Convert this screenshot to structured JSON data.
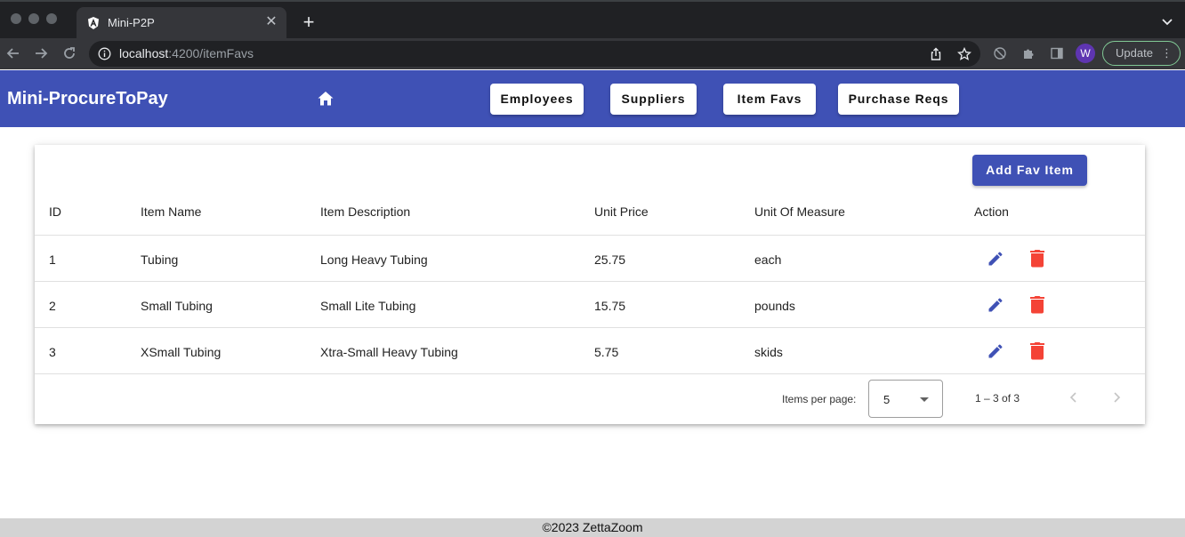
{
  "browser": {
    "tab_title": "Mini-P2P",
    "url_host": "localhost",
    "url_path": ":4200/itemFavs",
    "profile_initial": "W",
    "update_label": "Update"
  },
  "app": {
    "brand": "Mini-ProcureToPay",
    "nav": [
      "Employees",
      "Suppliers",
      "Item Favs",
      "Purchase Reqs"
    ]
  },
  "table": {
    "add_button": "Add Fav Item",
    "headers": [
      "ID",
      "Item Name",
      "Item Description",
      "Unit Price",
      "Unit Of Measure",
      "Action"
    ],
    "rows": [
      {
        "id": "1",
        "name": "Tubing",
        "description": "Long Heavy Tubing",
        "price": "25.75",
        "uom": "each"
      },
      {
        "id": "2",
        "name": "Small Tubing",
        "description": "Small Lite Tubing",
        "price": "15.75",
        "uom": "pounds"
      },
      {
        "id": "3",
        "name": "XSmall Tubing",
        "description": "Xtra-Small Heavy Tubing",
        "price": "5.75",
        "uom": "skids"
      }
    ]
  },
  "paginator": {
    "items_per_page_label": "Items per page:",
    "page_size": "5",
    "range_label": "1 – 3 of 3"
  },
  "footer": {
    "text": "©2023 ZettaZoom"
  },
  "colors": {
    "primary": "#3f51b5",
    "warn": "#f44336"
  }
}
